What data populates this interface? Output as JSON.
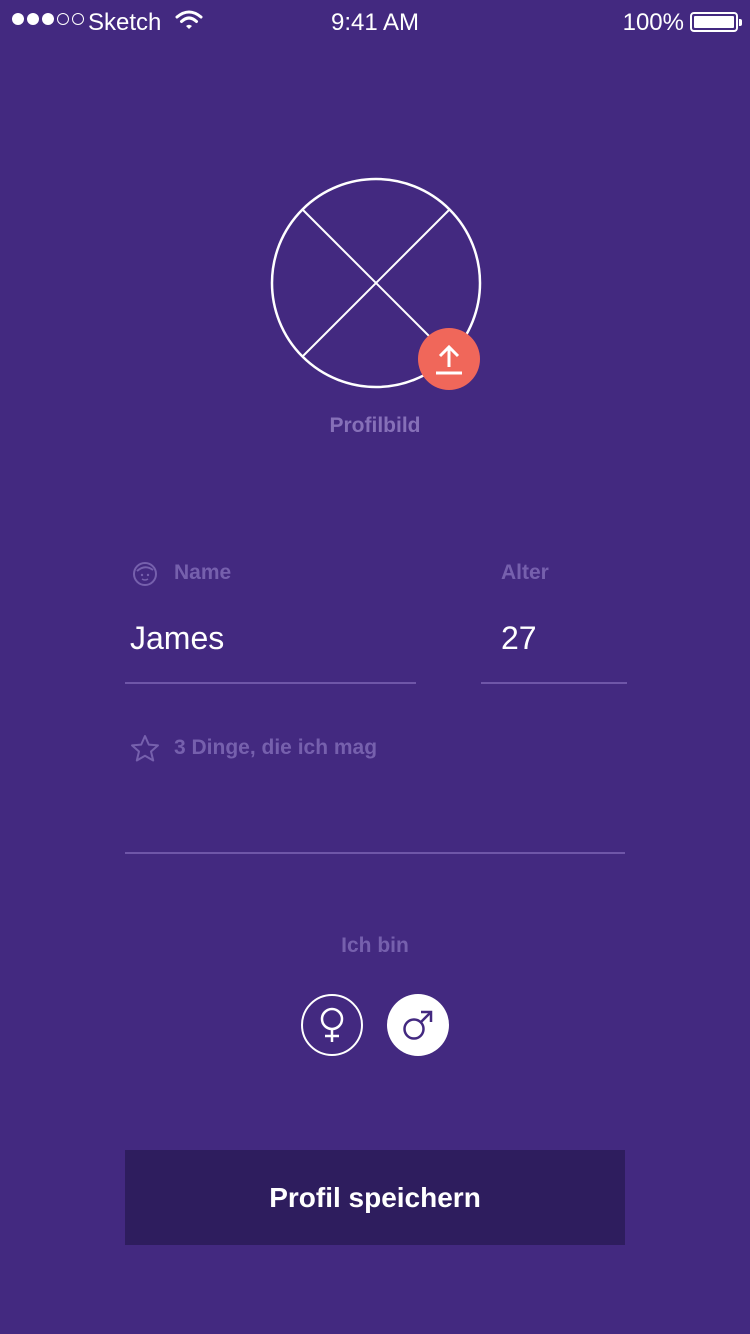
{
  "status_bar": {
    "carrier": "Sketch",
    "time": "9:41 AM",
    "battery": "100%",
    "signal_bars_filled": 3,
    "signal_bars_total": 5
  },
  "profile": {
    "image_caption": "Profilbild",
    "upload_icon": "upload-arrow-icon"
  },
  "form": {
    "name_label": "Name",
    "name_value": "James",
    "age_label": "Alter",
    "age_value": "27",
    "likes_label": "3 Dinge, die ich mag",
    "likes_value": "",
    "gender_label": "Ich bin",
    "gender_options": [
      "female",
      "male"
    ],
    "gender_selected": "male"
  },
  "actions": {
    "save_label": "Profil speichern"
  },
  "colors": {
    "background": "#432980",
    "accent": "#f0675a",
    "button_bg": "#2e1d5e",
    "label": "#7660ad"
  }
}
